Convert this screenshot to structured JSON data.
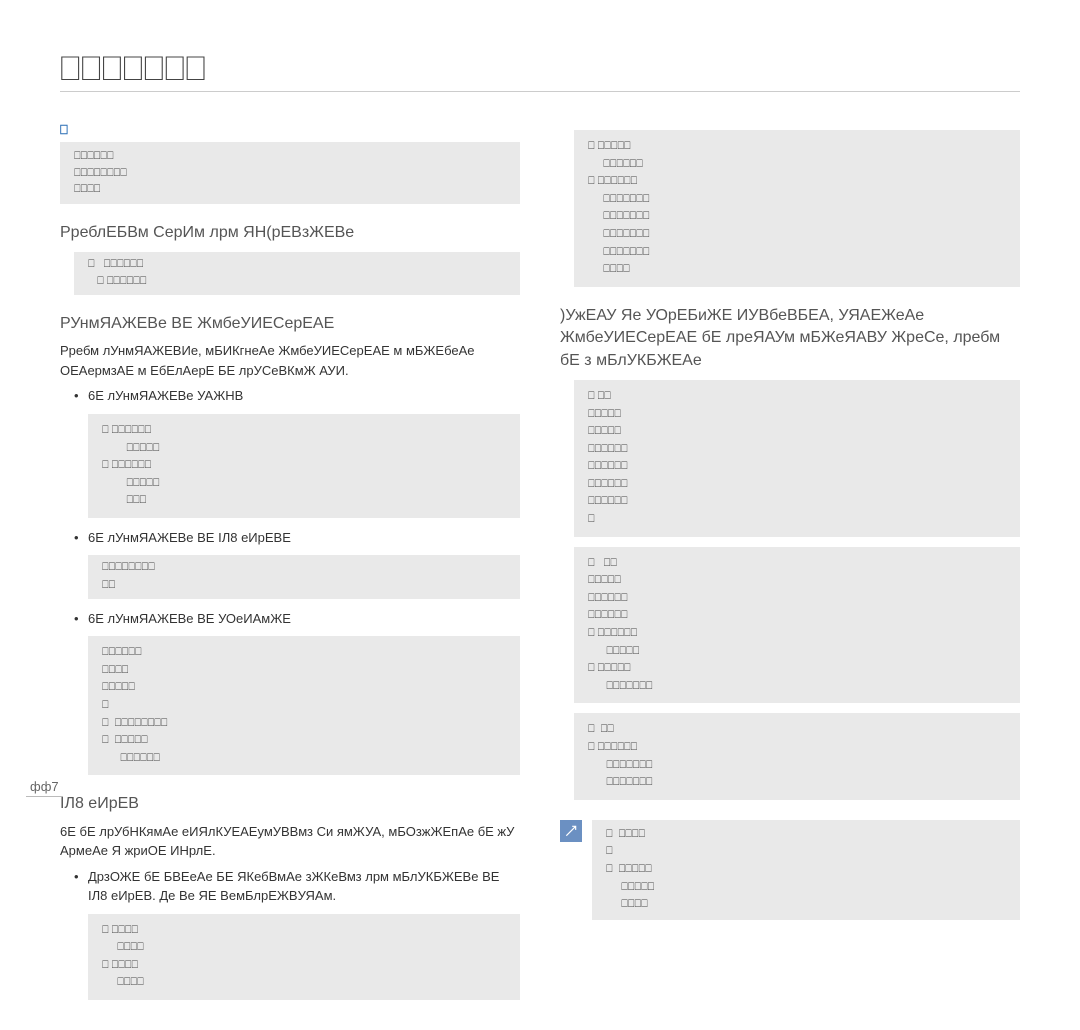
{
  "pageTitle": "⎕⎕⎕⎕⎕⎕⎕",
  "left": {
    "introMarker": "⎕",
    "introGrey": "⎕⎕⎕⎕⎕⎕\n⎕⎕⎕⎕⎕⎕⎕⎕\n⎕⎕⎕⎕",
    "sectionA": {
      "title": "РреблЕБВм СерИм лрм ЯН(рЕВзЖЕВе",
      "grey": "⎕   ⎕⎕⎕⎕⎕⎕\n   ⎕ ⎕⎕⎕⎕⎕⎕"
    },
    "sectionB": {
      "title": "РУнмЯАЖЕВе ВЕ ЖмбеУИЕСерЕАЕ",
      "body": "Рребм лУнмЯАЖЕВИe, мБИКгнеАе ЖмбеУИЕСерЕАЕ м мБЖЕбеАе ОЕАермзАЕ м ЕбЕлАерЕ БЕ лрУСеВКмЖ АУИ.",
      "bullet1": "6Е лУнмЯАЖЕВе УАЖНВ",
      "grey1": "⎕ ⎕⎕⎕⎕⎕⎕\n        ⎕⎕⎕⎕⎕\n⎕ ⎕⎕⎕⎕⎕⎕\n        ⎕⎕⎕⎕⎕\n        ⎕⎕⎕",
      "bullet2": "6Е лУнмЯАЖЕВе ВЕ IЛ8 еИрЕВЕ",
      "grey2": "⎕⎕⎕⎕⎕⎕⎕⎕\n⎕⎕",
      "bullet3": "6Е лУнмЯАЖЕВе ВЕ УОеИАмЖЕ",
      "grey3": "⎕⎕⎕⎕⎕⎕\n⎕⎕⎕⎕\n⎕⎕⎕⎕⎕\n⎕\n⎕  ⎕⎕⎕⎕⎕⎕⎕⎕\n⎕  ⎕⎕⎕⎕⎕\n      ⎕⎕⎕⎕⎕⎕"
    },
    "sectionC": {
      "title": "IЛ8 еИрЕВ",
      "body": "6Е бЕ лрУбНКямАе еИЯлКУЕАЕумУВВмз Си ямЖУА, мБОзжЖЕпАе бЕ жУ АрмеАе Я жриОЕ ИНрлЕ.",
      "bullet": "ДрзОЖЕ бЕ БВЕеАе БЕ ЯКебВмАе зЖКеВмз лрм мБлУКБЖЕВе ВЕ IЛ8 еИрЕВ. Де Ве ЯЕ ВемБлрЕЖBУЯАм.",
      "grey": "⎕ ⎕⎕⎕⎕\n     ⎕⎕⎕⎕\n⎕ ⎕⎕⎕⎕\n     ⎕⎕⎕⎕"
    }
  },
  "right": {
    "topGrey": "⎕ ⎕⎕⎕⎕⎕\n     ⎕⎕⎕⎕⎕⎕\n⎕ ⎕⎕⎕⎕⎕⎕\n     ⎕⎕⎕⎕⎕⎕⎕\n     ⎕⎕⎕⎕⎕⎕⎕\n     ⎕⎕⎕⎕⎕⎕⎕\n     ⎕⎕⎕⎕⎕⎕⎕\n     ⎕⎕⎕⎕",
    "sectionD": {
      "title": ")УжЕАУ Яе УОрЕБиЖЕ ИУВбеВБЕА, УЯАЕЖеАе ЖмбеУИЕСерЕАЕ бЕ лреЯАУм мБЖеЯАВУ ЖреСе, лребм бЕ з мБлУКБЖЕАе",
      "grey1": "⎕ ⎕⎕\n⎕⎕⎕⎕⎕\n⎕⎕⎕⎕⎕\n⎕⎕⎕⎕⎕⎕\n⎕⎕⎕⎕⎕⎕\n⎕⎕⎕⎕⎕⎕\n⎕⎕⎕⎕⎕⎕\n⎕",
      "grey2": "⎕   ⎕⎕\n⎕⎕⎕⎕⎕\n⎕⎕⎕⎕⎕⎕\n⎕⎕⎕⎕⎕⎕\n⎕ ⎕⎕⎕⎕⎕⎕\n      ⎕⎕⎕⎕⎕\n⎕ ⎕⎕⎕⎕⎕\n      ⎕⎕⎕⎕⎕⎕⎕",
      "grey3": "⎕  ⎕⎕\n⎕ ⎕⎕⎕⎕⎕⎕\n      ⎕⎕⎕⎕⎕⎕⎕\n      ⎕⎕⎕⎕⎕⎕⎕"
    },
    "note": "⎕  ⎕⎕⎕⎕\n⎕\n⎕  ⎕⎕⎕⎕⎕\n     ⎕⎕⎕⎕⎕\n     ⎕⎕⎕⎕"
  },
  "pageNumber": "фф7"
}
